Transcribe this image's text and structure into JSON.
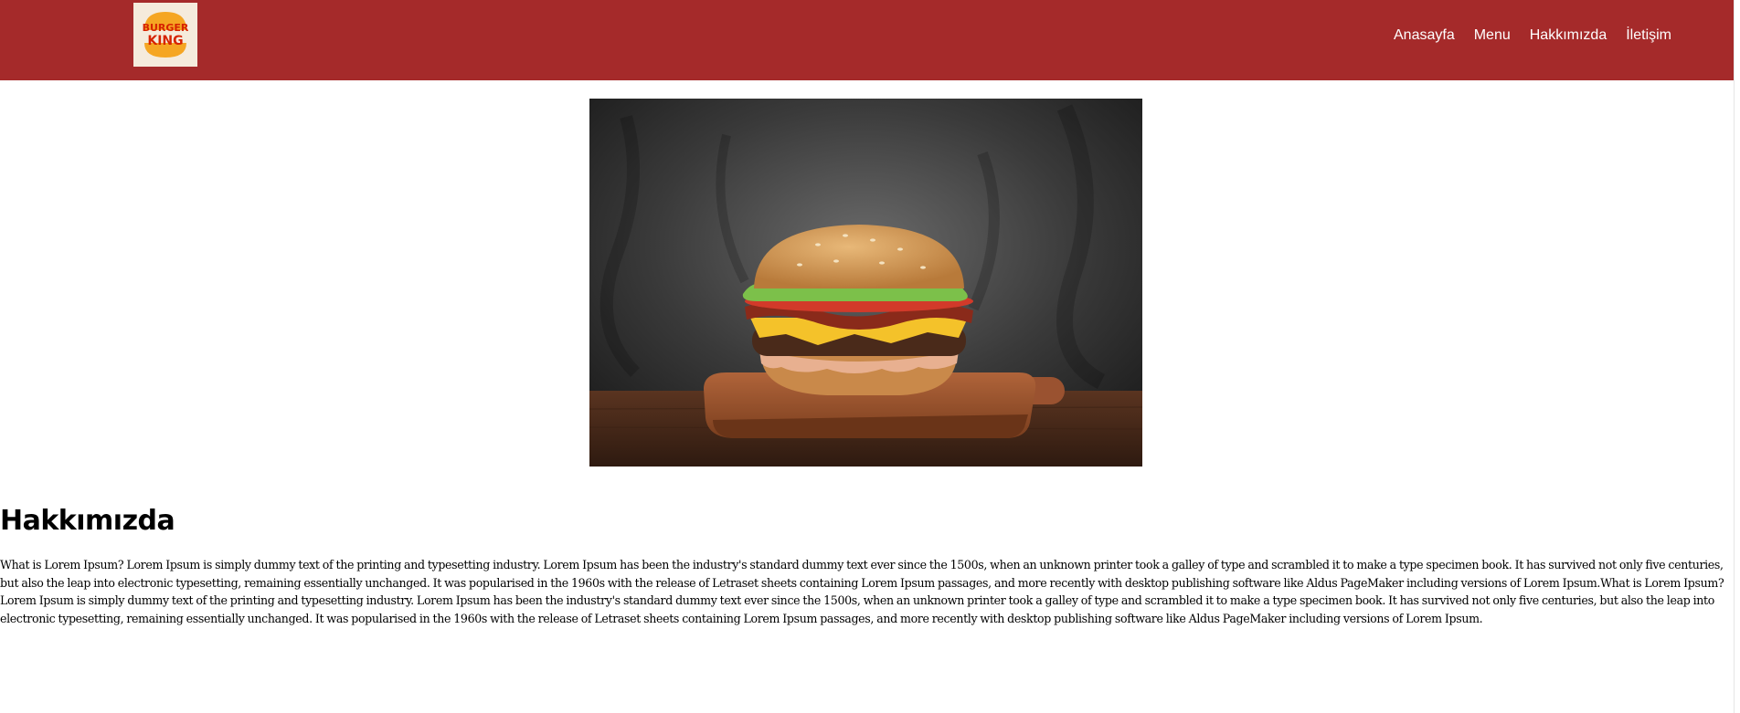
{
  "header": {
    "brand": "BURGER KING",
    "logo_text_line1": "BURGER",
    "logo_text_line2": "KING",
    "nav": [
      "Anasayfa",
      "Menu",
      "Hakkımızda",
      "İletişim"
    ],
    "colors": {
      "navbar": "#a52a2a",
      "nav_text": "#ffffff",
      "logo_bg": "#f5ebdc",
      "logo_red": "#d62300",
      "logo_bun": "#f5a623"
    }
  },
  "hero": {
    "icon": "burger-photo"
  },
  "about": {
    "title": "Hakkımızda",
    "text": "What is Lorem Ipsum? Lorem Ipsum is simply dummy text of the printing and typesetting industry. Lorem Ipsum has been the industry's standard dummy text ever since the 1500s, when an unknown printer took a galley of type and scrambled it to make a type specimen book. It has survived not only five centuries, but also the leap into electronic typesetting, remaining essentially unchanged. It was popularised in the 1960s with the release of Letraset sheets containing Lorem Ipsum passages, and more recently with desktop publishing software like Aldus PageMaker including versions of Lorem Ipsum.What is Lorem Ipsum? Lorem Ipsum is simply dummy text of the printing and typesetting industry. Lorem Ipsum has been the industry's standard dummy text ever since the 1500s, when an unknown printer took a galley of type and scrambled it to make a type specimen book. It has survived not only five centuries, but also the leap into electronic typesetting, remaining essentially unchanged. It was popularised in the 1960s with the release of Letraset sheets containing Lorem Ipsum passages, and more recently with desktop publishing software like Aldus PageMaker including versions of Lorem Ipsum."
  }
}
